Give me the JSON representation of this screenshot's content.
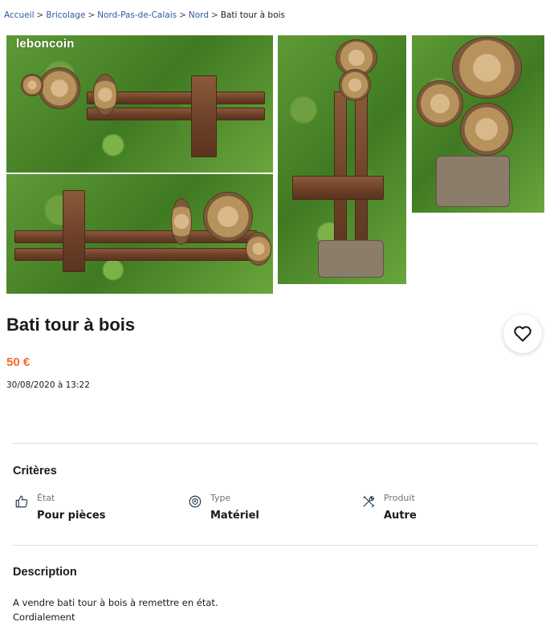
{
  "breadcrumb": {
    "items": [
      "Accueil",
      "Bricolage",
      "Nord-Pas-de-Calais",
      "Nord"
    ],
    "current": "Bati tour à bois",
    "separator": ">"
  },
  "gallery": {
    "watermark": "leboncoin"
  },
  "listing": {
    "title": "Bati tour à bois",
    "price": "50 €",
    "date": "30/08/2020 à 13:22"
  },
  "criteria": {
    "heading": "Critères",
    "items": [
      {
        "label": "État",
        "value": "Pour pièces",
        "icon": "thumbs-up-icon"
      },
      {
        "label": "Type",
        "value": "Matériel",
        "icon": "tool-type-icon"
      },
      {
        "label": "Produit",
        "value": "Autre",
        "icon": "tools-cross-icon"
      }
    ]
  },
  "description": {
    "heading": "Description",
    "lines": [
      "A vendre bati tour à bois à remettre en état.",
      "Cordialement"
    ]
  },
  "colors": {
    "price": "#f56b2a",
    "link": "#2c5aa0",
    "divider": "#d9dce0"
  }
}
